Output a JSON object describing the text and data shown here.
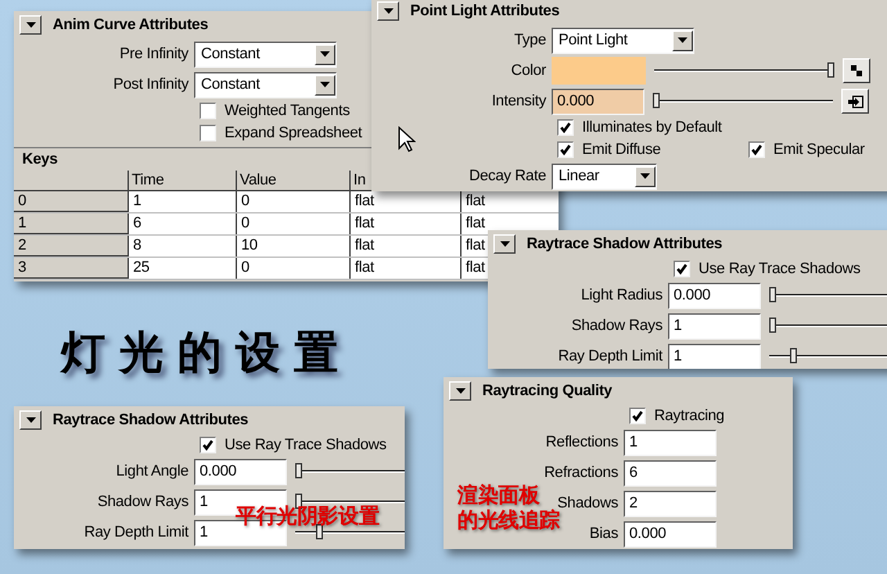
{
  "title": "灯光的设置",
  "panels": [
    {
      "title": "Anim Curve Attributes",
      "rows": [
        {
          "kind": "dropdown",
          "label": "Pre Infinity",
          "value": "Constant"
        },
        {
          "kind": "dropdown",
          "label": "Post Infinity",
          "value": "Constant"
        },
        {
          "kind": "checkbox",
          "label": "Weighted Tangents",
          "checked": false
        },
        {
          "kind": "checkbox",
          "label": "Expand Spreadsheet",
          "checked": false
        }
      ],
      "table": {
        "title": "Keys",
        "columns": [
          "",
          "Time",
          "Value",
          "In"
        ],
        "rows": [
          [
            "0",
            "1",
            "0",
            "flat",
            "flat"
          ],
          [
            "1",
            "6",
            "0",
            "flat",
            "flat"
          ],
          [
            "2",
            "8",
            "10",
            "flat",
            "flat"
          ],
          [
            "3",
            "25",
            "0",
            "flat",
            "flat"
          ]
        ]
      }
    },
    {
      "title": "Point Light Attributes",
      "rows": [
        {
          "kind": "dropdown",
          "label": "Type",
          "value": "Point Light"
        },
        {
          "kind": "color",
          "label": "Color",
          "color": "#fccb8a",
          "level": 1
        },
        {
          "kind": "field",
          "label": "Intensity",
          "value": "0.000",
          "level": 0,
          "keyed": true
        },
        {
          "kind": "checkbox",
          "label": "Illuminates by Default",
          "checked": true
        },
        {
          "kind": "checkboxes",
          "items": [
            {
              "label": "Emit Diffuse",
              "checked": true
            },
            {
              "label": "Emit Specular",
              "checked": true
            }
          ]
        },
        {
          "kind": "dropdown",
          "label": "Decay Rate",
          "value": "Linear"
        }
      ]
    },
    {
      "title": "Raytrace Shadow Attributes",
      "rows": [
        {
          "kind": "checkbox",
          "label": "Use Ray Trace Shadows",
          "checked": true
        },
        {
          "kind": "field",
          "label": "Light Radius",
          "value": "0.000",
          "level": 0
        },
        {
          "kind": "field",
          "label": "Shadow Rays",
          "value": "1",
          "level": 0
        },
        {
          "kind": "field",
          "label": "Ray Depth Limit",
          "value": "1",
          "level": 0.12
        }
      ]
    },
    {
      "title": "Raytrace Shadow Attributes",
      "caption": [
        "平行光阴影设置"
      ],
      "rows": [
        {
          "kind": "checkbox",
          "label": "Use Ray Trace Shadows",
          "checked": true
        },
        {
          "kind": "field",
          "label": "Light Angle",
          "value": "0.000",
          "level": 0
        },
        {
          "kind": "field",
          "label": "Shadow Rays",
          "value": "1",
          "level": 0
        },
        {
          "kind": "field",
          "label": "Ray Depth Limit",
          "value": "1",
          "level": 0.12
        }
      ]
    },
    {
      "title": "Raytracing Quality",
      "caption": [
        "渲染面板",
        "的光线追踪"
      ],
      "rows": [
        {
          "kind": "checkbox",
          "label": "Raytracing",
          "checked": true
        },
        {
          "kind": "field",
          "label": "Reflections",
          "value": "1"
        },
        {
          "kind": "field",
          "label": "Refractions",
          "value": "6"
        },
        {
          "kind": "field",
          "label": "Shadows",
          "value": "2"
        },
        {
          "kind": "field",
          "label": "Bias",
          "value": "0.000"
        }
      ]
    }
  ]
}
